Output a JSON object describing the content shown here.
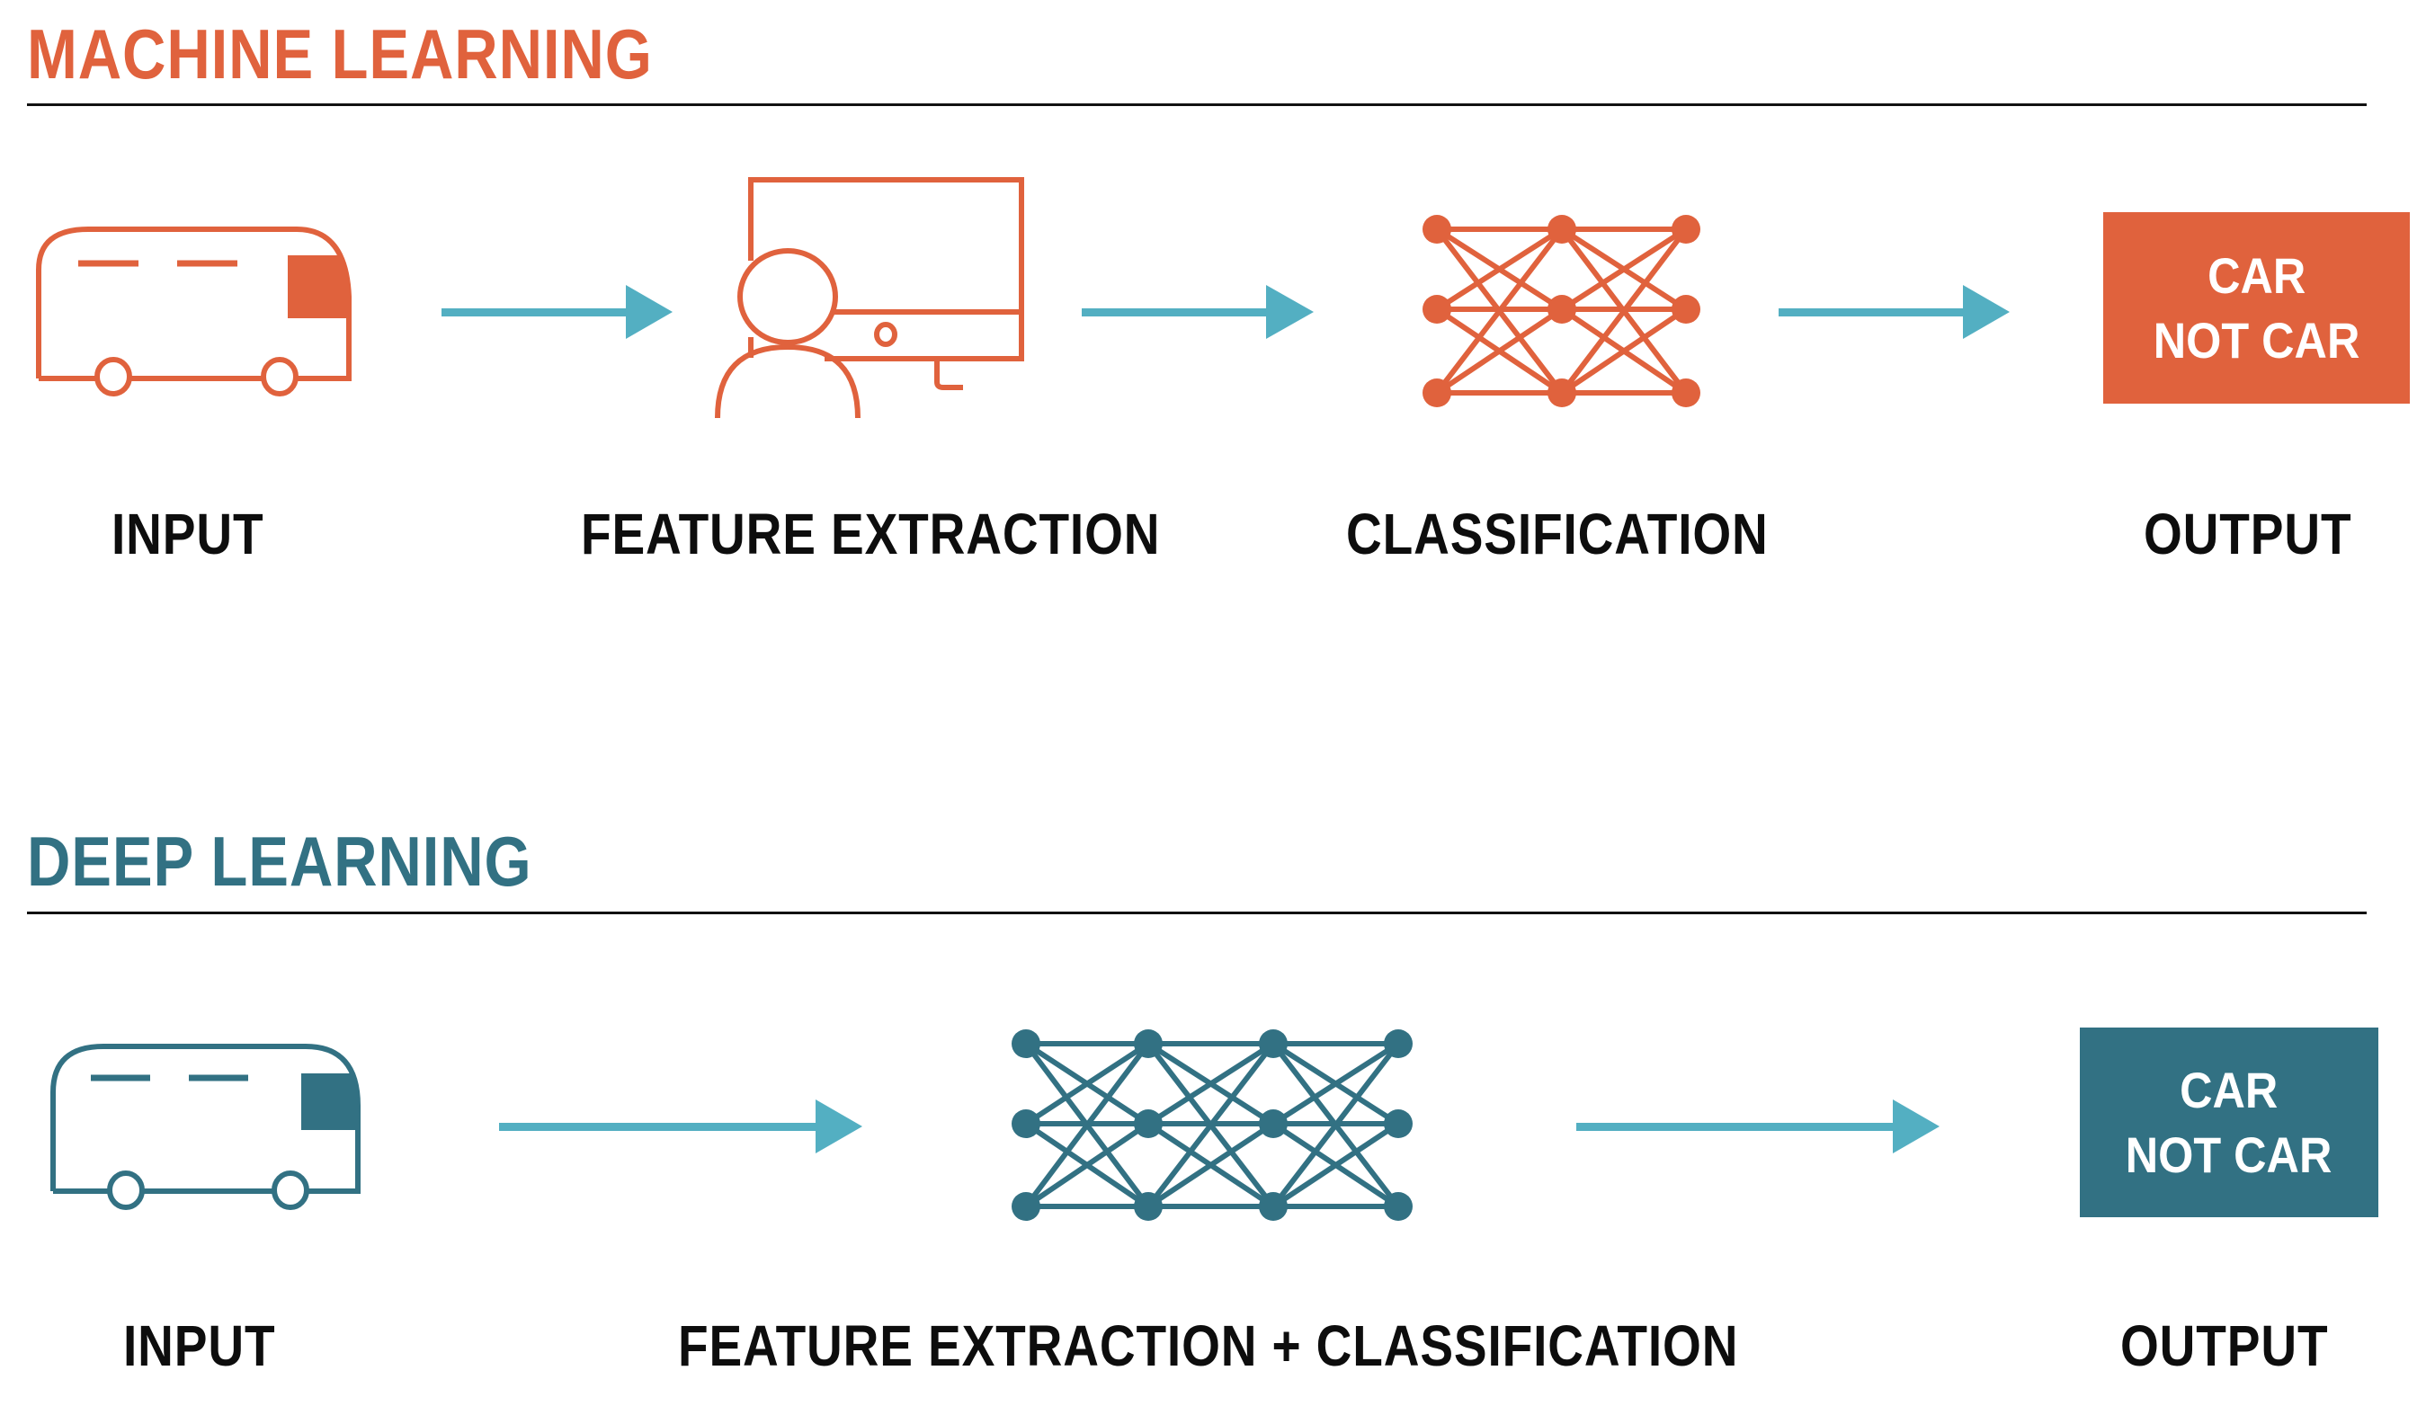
{
  "colors": {
    "machine_learning": "#E0623D",
    "deep_learning": "#327183",
    "arrow": "#53AFC2",
    "text": "#0D0D0D",
    "rule": "#111111"
  },
  "machine_learning": {
    "title": "MACHINE LEARNING",
    "stages": [
      {
        "label": "INPUT",
        "icon": "bus-icon"
      },
      {
        "label": "FEATURE EXTRACTION",
        "icon": "person-at-monitor-icon"
      },
      {
        "label": "CLASSIFICATION",
        "icon": "neural-network-icon"
      },
      {
        "label": "OUTPUT",
        "icon": "output-box"
      }
    ],
    "output_box": {
      "line1": "CAR",
      "line2": "NOT CAR"
    },
    "network_layers": [
      3,
      3,
      3
    ]
  },
  "deep_learning": {
    "title": "DEEP LEARNING",
    "stages": [
      {
        "label": "INPUT",
        "icon": "bus-icon"
      },
      {
        "label": "FEATURE EXTRACTION + CLASSIFICATION",
        "icon": "neural-network-icon"
      },
      {
        "label": "OUTPUT",
        "icon": "output-box"
      }
    ],
    "output_box": {
      "line1": "CAR",
      "line2": "NOT CAR"
    },
    "network_layers": [
      3,
      3,
      3,
      3
    ]
  }
}
